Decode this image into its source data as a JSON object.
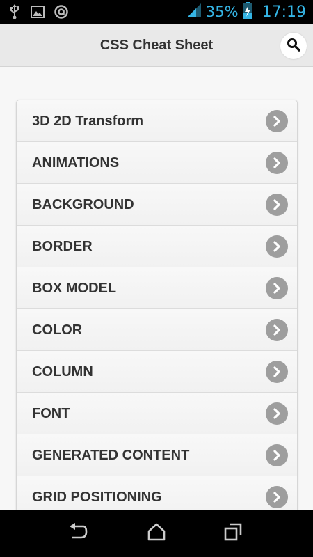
{
  "status_bar": {
    "icons": [
      "usb-icon",
      "image-icon",
      "app-notification-icon",
      "signal-icon",
      "battery-charging-icon"
    ],
    "battery_percent": "35%",
    "time": "17:19",
    "color": "#35b5e5"
  },
  "header": {
    "title": "CSS Cheat Sheet",
    "search_icon": "search-icon"
  },
  "list": {
    "items": [
      {
        "label": "3D 2D Transform"
      },
      {
        "label": "ANIMATIONS"
      },
      {
        "label": "BACKGROUND"
      },
      {
        "label": "BORDER"
      },
      {
        "label": "BOX MODEL"
      },
      {
        "label": "COLOR"
      },
      {
        "label": "COLUMN"
      },
      {
        "label": "FONT"
      },
      {
        "label": "GENERATED CONTENT"
      },
      {
        "label": "GRID POSITIONING"
      }
    ],
    "chevron_icon": "chevron-right-icon"
  },
  "nav_bar": {
    "buttons": [
      "back-icon",
      "home-icon",
      "recent-apps-icon"
    ]
  }
}
